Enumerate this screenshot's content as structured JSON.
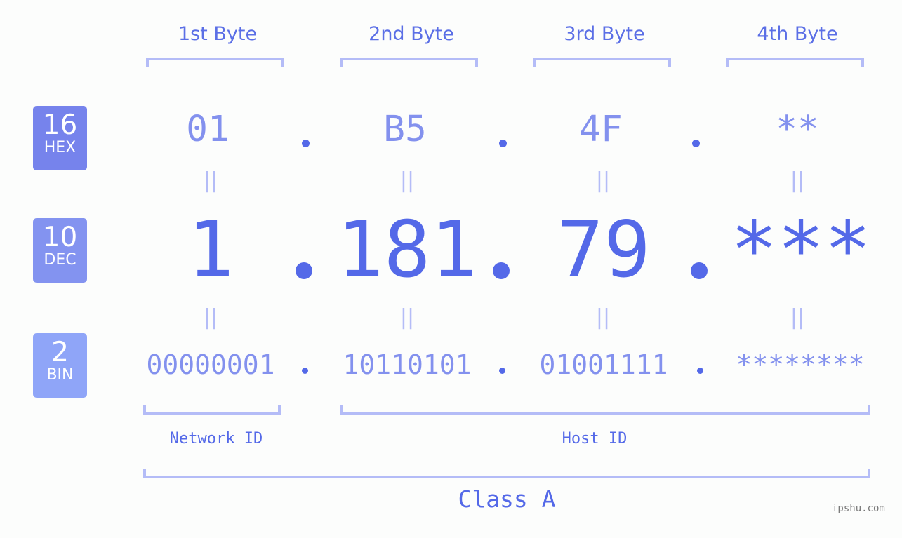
{
  "headers": [
    "1st Byte",
    "2nd Byte",
    "3rd Byte",
    "4th Byte"
  ],
  "badges": {
    "hex": {
      "number": "16",
      "label": "HEX",
      "color": "#7683ec"
    },
    "dec": {
      "number": "10",
      "label": "DEC",
      "color": "#8393f0"
    },
    "bin": {
      "number": "2",
      "label": "BIN",
      "color": "#8fa5f8"
    }
  },
  "hex_values": [
    "01",
    "B5",
    "4F",
    "**"
  ],
  "dec_values": [
    "1",
    "181",
    "79",
    "***"
  ],
  "bin_values": [
    "00000001",
    "10110101",
    "01001111",
    "********"
  ],
  "equals_symbol": "||",
  "segments": {
    "network": "Network ID",
    "host": "Host ID",
    "class": "Class A"
  },
  "watermark": "ipshu.com",
  "colors": {
    "accent": "#5469e8",
    "light": "#8391ee",
    "bracket": "#b4bcf7",
    "background": "#fcfdfc"
  }
}
